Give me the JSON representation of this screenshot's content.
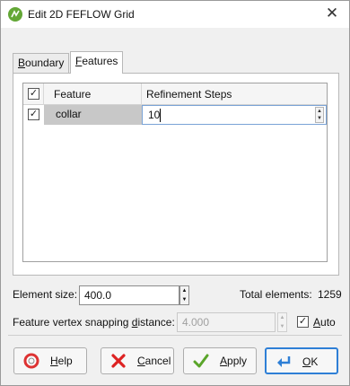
{
  "window": {
    "title": "Edit 2D FEFLOW Grid"
  },
  "tabs": [
    {
      "label_first": "B",
      "label_rest": "oundary"
    },
    {
      "label_first": "F",
      "label_rest": "eatures"
    }
  ],
  "grid": {
    "headers": {
      "select_all_mark": "✓",
      "feature": "Feature",
      "refinement": "Refinement Steps"
    },
    "rows": [
      {
        "checked_mark": "✓",
        "feature": "collar",
        "refinement": "10"
      }
    ]
  },
  "element_size": {
    "label": "Element size:",
    "value": "400.0"
  },
  "total_elements": {
    "label": "Total elements:",
    "value": "1259"
  },
  "snapping": {
    "label_pre": "Feature vertex snapping ",
    "label_underline": "d",
    "label_post": "istance:",
    "value": "4.000",
    "auto_mark": "✓",
    "auto_first": "A",
    "auto_rest": "uto"
  },
  "buttons": {
    "help": {
      "underline": "H",
      "rest": "elp"
    },
    "cancel": {
      "underline": "C",
      "rest": "ancel"
    },
    "apply": {
      "underline": "A",
      "rest": "pply"
    },
    "ok": {
      "underline": "O",
      "rest": "K"
    }
  },
  "colors": {
    "accent": "#2e7fd6",
    "app_icon": "#63a736",
    "selected_row": "#c8c8c8"
  }
}
